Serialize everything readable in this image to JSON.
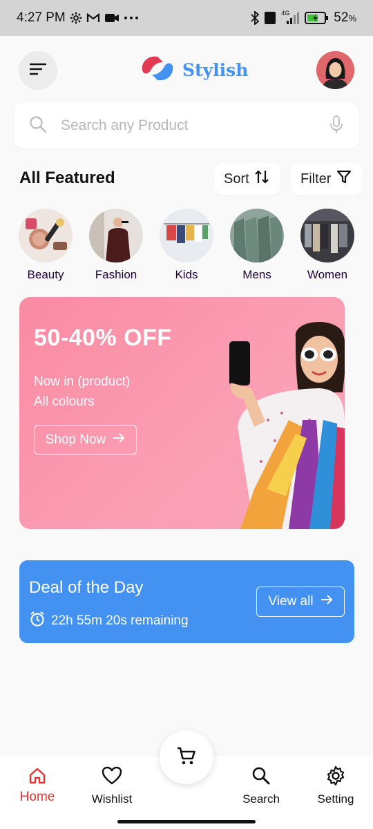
{
  "status_bar": {
    "time": "4:27 PM",
    "network": "4G",
    "battery": "52",
    "battery_unit": "%"
  },
  "header": {
    "brand": "Stylish",
    "brand_color": "#4392f1",
    "menu_icon": "menu-lines-icon",
    "avatar": "user-avatar"
  },
  "search": {
    "placeholder": "Search any Product"
  },
  "featured": {
    "title": "All Featured",
    "sort_label": "Sort",
    "filter_label": "Filter"
  },
  "categories": [
    {
      "label": "Beauty"
    },
    {
      "label": "Fashion"
    },
    {
      "label": "Kids"
    },
    {
      "label": "Mens"
    },
    {
      "label": "Women"
    }
  ],
  "banner": {
    "title": "50-40% OFF",
    "line1": "Now in (product)",
    "line2": "All colours",
    "button": "Shop Now"
  },
  "deal": {
    "title": "Deal of the Day",
    "timer": "22h 55m 20s remaining",
    "button": "View all",
    "color": "#4392f1"
  },
  "nav": {
    "home": "Home",
    "wishlist": "Wishlist",
    "search": "Search",
    "setting": "Setting",
    "active_color": "#eb3030"
  }
}
